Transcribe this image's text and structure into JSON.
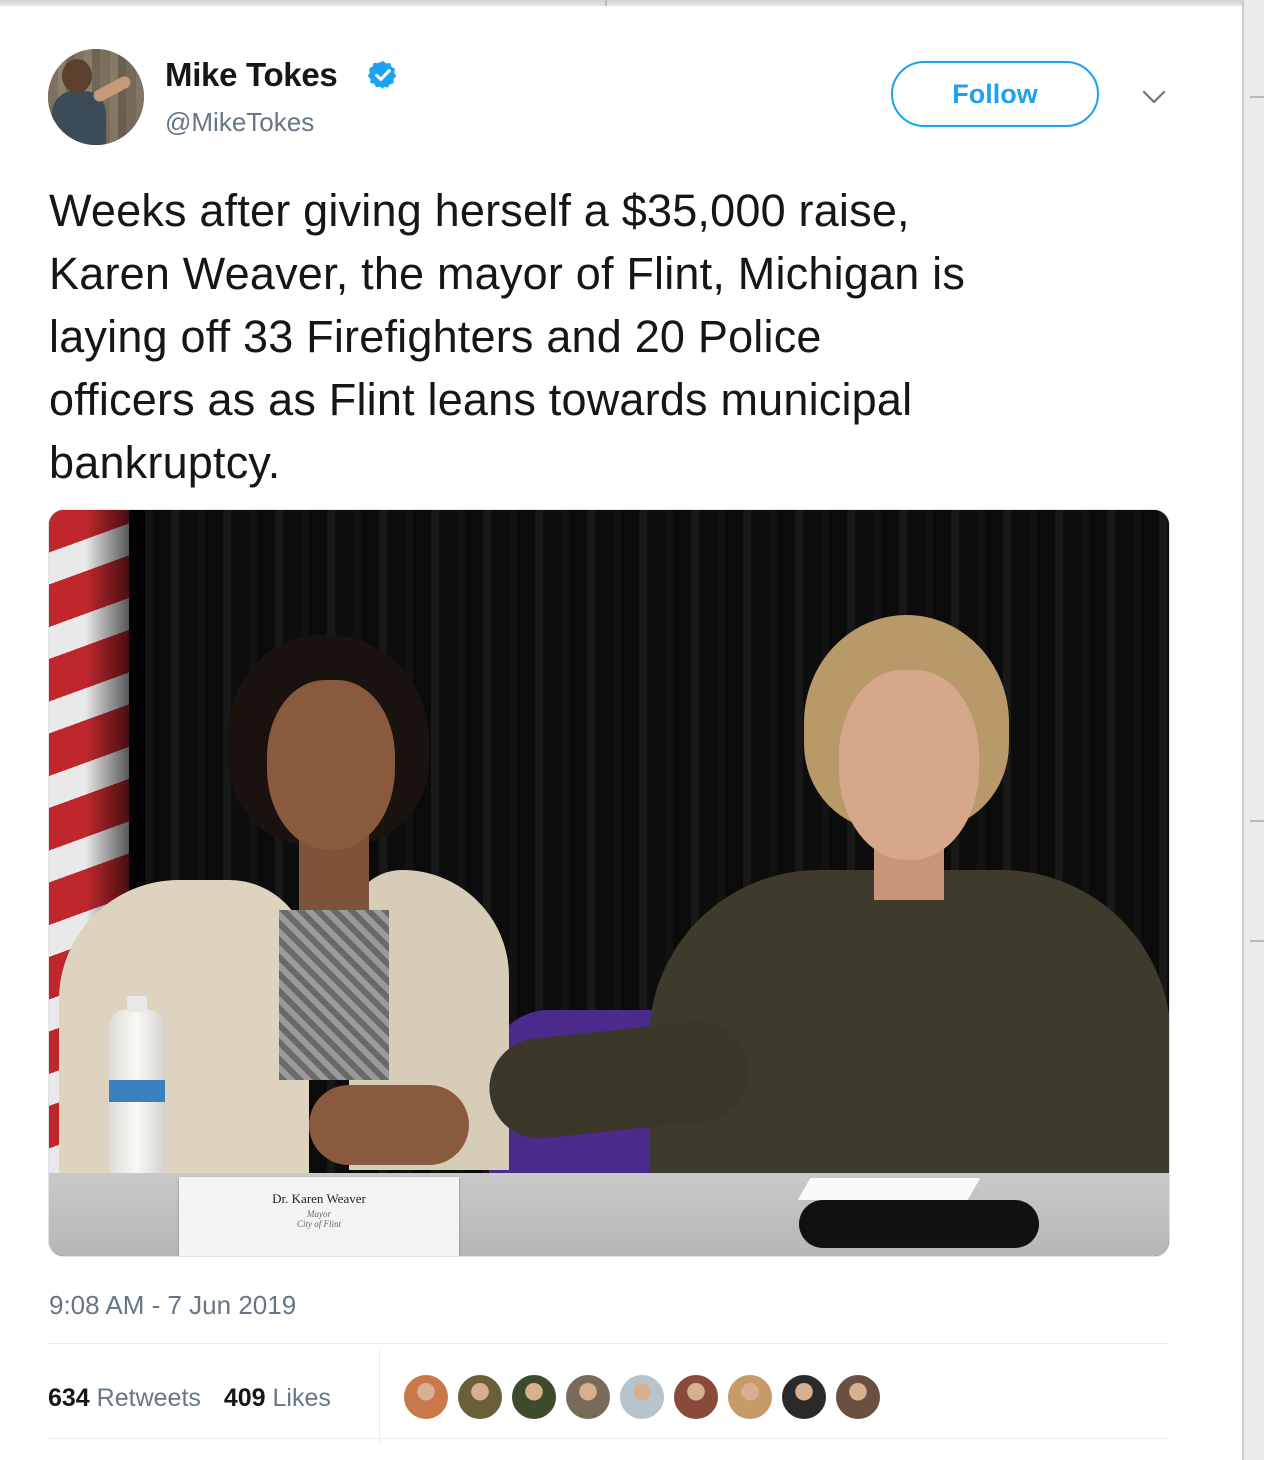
{
  "author": {
    "name": "Mike Tokes",
    "handle": "@MikeTokes",
    "verified": true,
    "avatar_icon": "profile-avatar"
  },
  "actions": {
    "follow_label": "Follow",
    "menu_icon": "chevron-down-icon"
  },
  "tweet": {
    "text": "Weeks after giving herself a $35,000 raise,\nKaren Weaver, the mayor of Flint, Michigan is\nlaying off 33 Firefighters and 20 Police\nofficers as as Flint leans towards municipal\nbankruptcy.",
    "timestamp": "9:08 AM - 7 Jun 2019"
  },
  "photo": {
    "nameplate": {
      "name": "Dr. Karen Weaver",
      "subtitle_line1": "Mayor",
      "subtitle_line2": "City of Flint"
    }
  },
  "stats": {
    "retweets_count": "634",
    "retweets_label": "Retweets",
    "likes_count": "409",
    "likes_label": "Likes"
  },
  "liker_avatars": [
    {
      "color": "#c9784a"
    },
    {
      "color": "#6b5e3a"
    },
    {
      "color": "#3d4a2c"
    },
    {
      "color": "#7a6a5a"
    },
    {
      "color": "#b8c4cc"
    },
    {
      "color": "#8a4a3a"
    },
    {
      "color": "#c79a6a"
    },
    {
      "color": "#2a2a2a"
    },
    {
      "color": "#6a5040"
    }
  ],
  "colors": {
    "accent": "#1da1f2",
    "text_primary": "#14171a",
    "text_secondary": "#657786"
  }
}
